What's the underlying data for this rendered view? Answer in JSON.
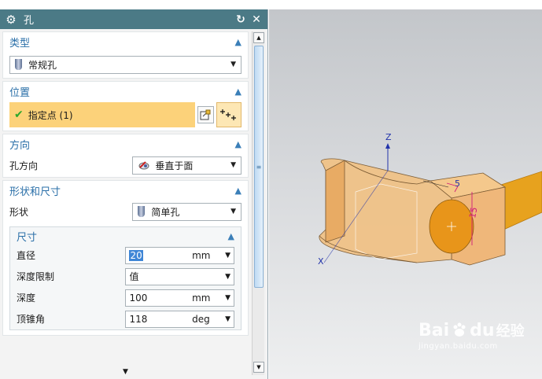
{
  "dialog": {
    "title": "孔",
    "sections": {
      "type": {
        "header": "类型",
        "value": "常规孔"
      },
      "position": {
        "header": "位置",
        "point_label": "指定点 (1)"
      },
      "direction": {
        "header": "方向",
        "label": "孔方向",
        "value": "垂直于面"
      },
      "shape": {
        "header": "形状和尺寸",
        "shape_label": "形状",
        "shape_value": "简单孔",
        "dims": {
          "header": "尺寸",
          "diameter_label": "直径",
          "diameter_value": "20",
          "diameter_unit": "mm",
          "depth_limit_label": "深度限制",
          "depth_limit_value": "值",
          "depth_label": "深度",
          "depth_value": "100",
          "depth_unit": "mm",
          "tip_angle_label": "顶锥角",
          "tip_angle_value": "118",
          "tip_angle_unit": "deg"
        }
      }
    }
  },
  "viewport": {
    "axis_z": "Z",
    "axis_x": "X",
    "dim_5": "5",
    "dim_15": "15"
  },
  "watermark": {
    "brand": "Bai",
    "brand2": "du",
    "brand3": "经验",
    "url": "jingyan.baidu.com"
  },
  "colors": {
    "titlebar": "#4b7a86",
    "accent": "#2a6fa8",
    "highlight": "#fcd27a"
  }
}
